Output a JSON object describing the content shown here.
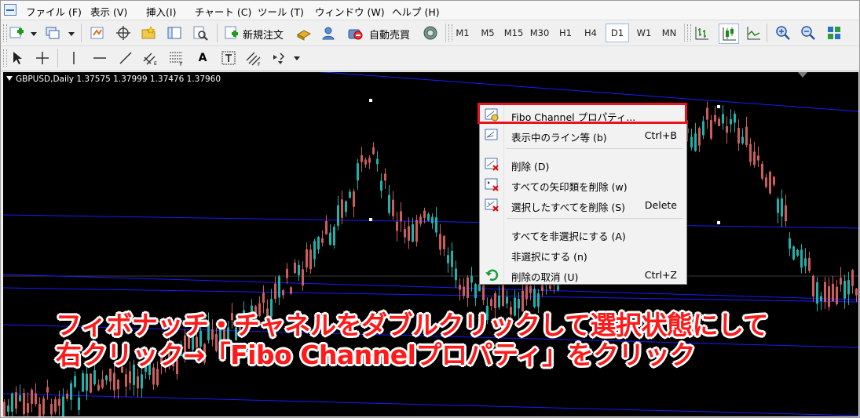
{
  "menu": {
    "items": [
      "ファイル (F)",
      "表示 (V)",
      "挿入(I)",
      "チャート (C)",
      "ツール (T)",
      "ウィンドウ (W)",
      "ヘルプ (H)"
    ]
  },
  "toolbar": {
    "new_order": "新規注文",
    "auto_trade": "自動売買",
    "timeframes": [
      "M1",
      "M5",
      "M15",
      "M30",
      "H1",
      "H4",
      "D1",
      "W1",
      "MN"
    ],
    "active_timeframe": "D1",
    "text_tool": "A"
  },
  "chart": {
    "header": "GBPUSD,Daily  1.37575 1.37999 1.37476 1.37960",
    "bg_color": "#000000",
    "bull_color": "#20b2aa",
    "bear_color": "#cd5c5c",
    "channel_color": "#1a1aff"
  },
  "context_menu": {
    "items": [
      {
        "label": "Fibo Channel プロパティ...",
        "shortcut": ""
      },
      {
        "label": "表示中のライン等 (b)",
        "shortcut": "Ctrl+B"
      },
      {
        "label": "削除 (D)",
        "shortcut": ""
      },
      {
        "label": "すべての矢印類を削除 (w)",
        "shortcut": ""
      },
      {
        "label": "選択したすべてを削除 (S)",
        "shortcut": "Delete"
      },
      {
        "label": "すべてを非選択にする (A)",
        "shortcut": ""
      },
      {
        "label": "非選択にする (n)",
        "shortcut": ""
      },
      {
        "label": "削除の取消 (U)",
        "shortcut": "Ctrl+Z"
      }
    ],
    "highlight_color": "#e8141d"
  },
  "annotation": {
    "line1": "フィボナッチ・チャネルをダブルクリックして選択状態にして",
    "line2": "右クリック→「Fibo Channelプロパティ」をクリック",
    "color": "#ff1a1a"
  }
}
